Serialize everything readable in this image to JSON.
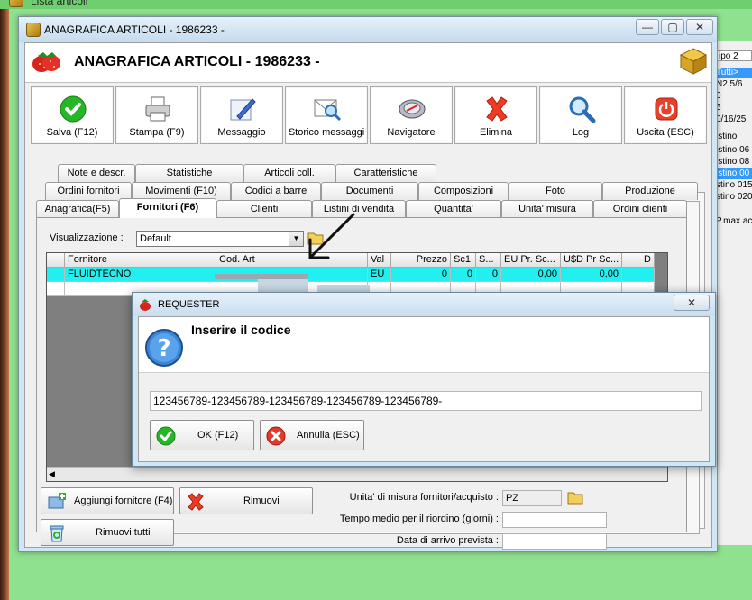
{
  "background_window": {
    "title": "Lista articoli",
    "right_lines": [
      {
        "text": "ipo 2",
        "selected": false
      },
      {
        "text": "Tutti>",
        "selected": true
      },
      {
        "text": "N2.5/6",
        "selected": false
      },
      {
        "text": "0",
        "selected": false
      },
      {
        "text": "6",
        "selected": false
      },
      {
        "text": "0/16/25",
        "selected": false
      },
      {
        "text": "istino",
        "selected": false
      },
      {
        "text": "istino 06",
        "selected": false
      },
      {
        "text": "istino 08",
        "selected": false
      },
      {
        "text": "istino 00",
        "selected": true
      },
      {
        "text": "stino 015",
        "selected": false
      },
      {
        "text": "stino 020",
        "selected": false
      },
      {
        "text": "P.max ac",
        "selected": false
      }
    ]
  },
  "main_window": {
    "title": "ANAGRAFICA ARTICOLI - 1986233 -",
    "header_title": "ANAGRAFICA ARTICOLI - 1986233 -",
    "controls": {
      "minimize": "—",
      "maximize": "▢",
      "close": "✕"
    },
    "toolbar": [
      {
        "name": "salva",
        "label": "Salva (F12)",
        "icon": "check-icon"
      },
      {
        "name": "stampa",
        "label": "Stampa (F9)",
        "icon": "printer-icon"
      },
      {
        "name": "messaggio",
        "label": "Messaggio",
        "icon": "pen-icon"
      },
      {
        "name": "storico",
        "label": "Storico messaggi",
        "icon": "mail-search-icon"
      },
      {
        "name": "navigatore",
        "label": "Navigatore",
        "icon": "compass-icon"
      },
      {
        "name": "elimina",
        "label": "Elimina",
        "icon": "delete-x-icon"
      },
      {
        "name": "log",
        "label": "Log",
        "icon": "magnifier-icon"
      },
      {
        "name": "uscita",
        "label": "Uscita (ESC)",
        "icon": "power-icon"
      }
    ],
    "tabs_row1": [
      "Note e descr.",
      "Statistiche",
      "Articoli coll.",
      "Caratteristiche"
    ],
    "tabs_row2": [
      "Ordini fornitori",
      "Movimenti (F10)",
      "Codici a barre",
      "Documenti",
      "Composizioni",
      "Foto",
      "Produzione"
    ],
    "tabs_row3": [
      "Anagrafica(F5)",
      "Fornitori (F6)",
      "Clienti",
      "Listini di vendita",
      "Quantita'",
      "Unita' misura",
      "Ordini clienti"
    ],
    "active_tab": "Fornitori (F6)",
    "visualizzazione_label": "Visualizzazione :",
    "visualizzazione_value": "Default",
    "grid": {
      "columns": [
        "Fornitore",
        "Cod. Art",
        "Val",
        "Prezzo",
        "Sc1",
        "S...",
        "EU Pr. Sc...",
        "U$D Pr Sc...",
        "D"
      ],
      "rows": [
        [
          "FLUIDTECNO",
          "",
          "EU",
          "0",
          "0",
          "0",
          "0,00",
          "0,00",
          ""
        ]
      ]
    },
    "buttons": {
      "aggiungi": "Aggiungi fornitore (F4)",
      "rimuovi": "Rimuovi",
      "rimuovi_tutti": "Rimuovi tutti"
    },
    "fields": {
      "unita_label": "Unita' di misura fornitori/acquisto :",
      "unita_value": "PZ",
      "tempo_label": "Tempo medio per il riordino (giorni) :",
      "tempo_value": "",
      "data_label": "Data di arrivo prevista :",
      "data_value": ""
    }
  },
  "requester": {
    "title": "REQUESTER",
    "close": "✕",
    "prompt": "Inserire il codice",
    "input_value": "123456789-123456789-123456789-123456789-123456789-",
    "ok_label": "OK (F12)",
    "cancel_label": "Annulla (ESC)"
  },
  "colors": {
    "selected_row": "#22f0f0",
    "window_frame": "#cfe6f3",
    "desktop": "#8fe08f"
  }
}
